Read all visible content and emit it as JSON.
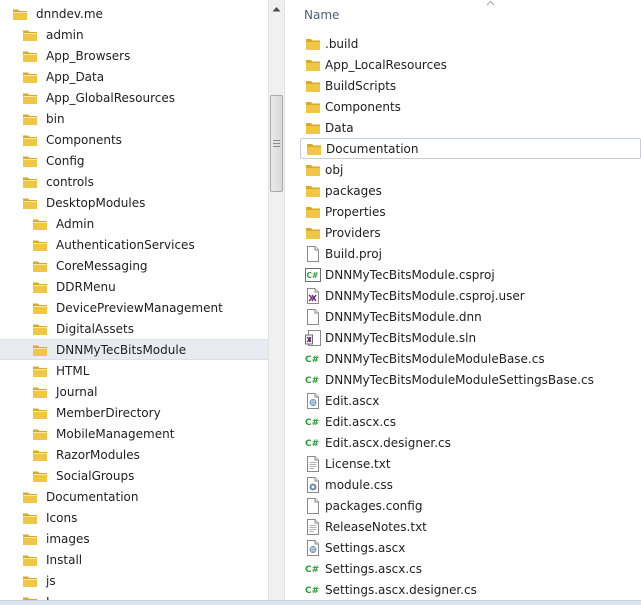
{
  "colors": {
    "folder": "#f0c646",
    "folder_dark": "#d9a928",
    "selection": "#e8ebf0",
    "header_text": "#4c607a",
    "csharp": "#2f9a3a",
    "vs_purple": "#68217a"
  },
  "nav": {
    "items": [
      {
        "label": "dnndev.me",
        "level": 0
      },
      {
        "label": "admin",
        "level": 1
      },
      {
        "label": "App_Browsers",
        "level": 1
      },
      {
        "label": "App_Data",
        "level": 1
      },
      {
        "label": "App_GlobalResources",
        "level": 1
      },
      {
        "label": "bin",
        "level": 1
      },
      {
        "label": "Components",
        "level": 1
      },
      {
        "label": "Config",
        "level": 1
      },
      {
        "label": "controls",
        "level": 1
      },
      {
        "label": "DesktopModules",
        "level": 1
      },
      {
        "label": "Admin",
        "level": 2
      },
      {
        "label": "AuthenticationServices",
        "level": 2
      },
      {
        "label": "CoreMessaging",
        "level": 2
      },
      {
        "label": "DDRMenu",
        "level": 2
      },
      {
        "label": "DevicePreviewManagement",
        "level": 2
      },
      {
        "label": "DigitalAssets",
        "level": 2
      },
      {
        "label": "DNNMyTecBitsModule",
        "level": 2,
        "selected": true
      },
      {
        "label": "HTML",
        "level": 2
      },
      {
        "label": "Journal",
        "level": 2
      },
      {
        "label": "MemberDirectory",
        "level": 2
      },
      {
        "label": "MobileManagement",
        "level": 2
      },
      {
        "label": "RazorModules",
        "level": 2
      },
      {
        "label": "SocialGroups",
        "level": 2
      },
      {
        "label": "Documentation",
        "level": 1
      },
      {
        "label": "Icons",
        "level": 1
      },
      {
        "label": "images",
        "level": 1
      },
      {
        "label": "Install",
        "level": 1
      },
      {
        "label": "js",
        "level": 1
      },
      {
        "label": "L",
        "level": 1
      }
    ]
  },
  "files": {
    "column_name": "Name",
    "items": [
      {
        "label": ".build",
        "icon": "folder-icon"
      },
      {
        "label": "App_LocalResources",
        "icon": "folder-icon"
      },
      {
        "label": "BuildScripts",
        "icon": "folder-icon"
      },
      {
        "label": "Components",
        "icon": "folder-icon"
      },
      {
        "label": "Data",
        "icon": "folder-icon"
      },
      {
        "label": "Documentation",
        "icon": "folder-icon",
        "focused": true
      },
      {
        "label": "obj",
        "icon": "folder-icon"
      },
      {
        "label": "packages",
        "icon": "folder-icon"
      },
      {
        "label": "Properties",
        "icon": "folder-icon"
      },
      {
        "label": "Providers",
        "icon": "folder-icon"
      },
      {
        "label": "Build.proj",
        "icon": "document-icon"
      },
      {
        "label": "DNNMyTecBitsModule.csproj",
        "icon": "csproj-icon"
      },
      {
        "label": "DNNMyTecBitsModule.csproj.user",
        "icon": "vs-user-icon"
      },
      {
        "label": "DNNMyTecBitsModule.dnn",
        "icon": "document-icon"
      },
      {
        "label": "DNNMyTecBitsModule.sln",
        "icon": "solution-icon"
      },
      {
        "label": "DNNMyTecBitsModuleModuleBase.cs",
        "icon": "csharp-icon"
      },
      {
        "label": "DNNMyTecBitsModuleModuleSettingsBase.cs",
        "icon": "csharp-icon"
      },
      {
        "label": "Edit.ascx",
        "icon": "ascx-icon"
      },
      {
        "label": "Edit.ascx.cs",
        "icon": "csharp-icon"
      },
      {
        "label": "Edit.ascx.designer.cs",
        "icon": "csharp-icon"
      },
      {
        "label": "License.txt",
        "icon": "text-file-icon"
      },
      {
        "label": "module.css",
        "icon": "css-icon"
      },
      {
        "label": "packages.config",
        "icon": "document-icon"
      },
      {
        "label": "ReleaseNotes.txt",
        "icon": "text-file-icon"
      },
      {
        "label": "Settings.ascx",
        "icon": "ascx-icon"
      },
      {
        "label": "Settings.ascx.cs",
        "icon": "csharp-icon"
      },
      {
        "label": "Settings.ascx.designer.cs",
        "icon": "csharp-icon"
      }
    ]
  }
}
